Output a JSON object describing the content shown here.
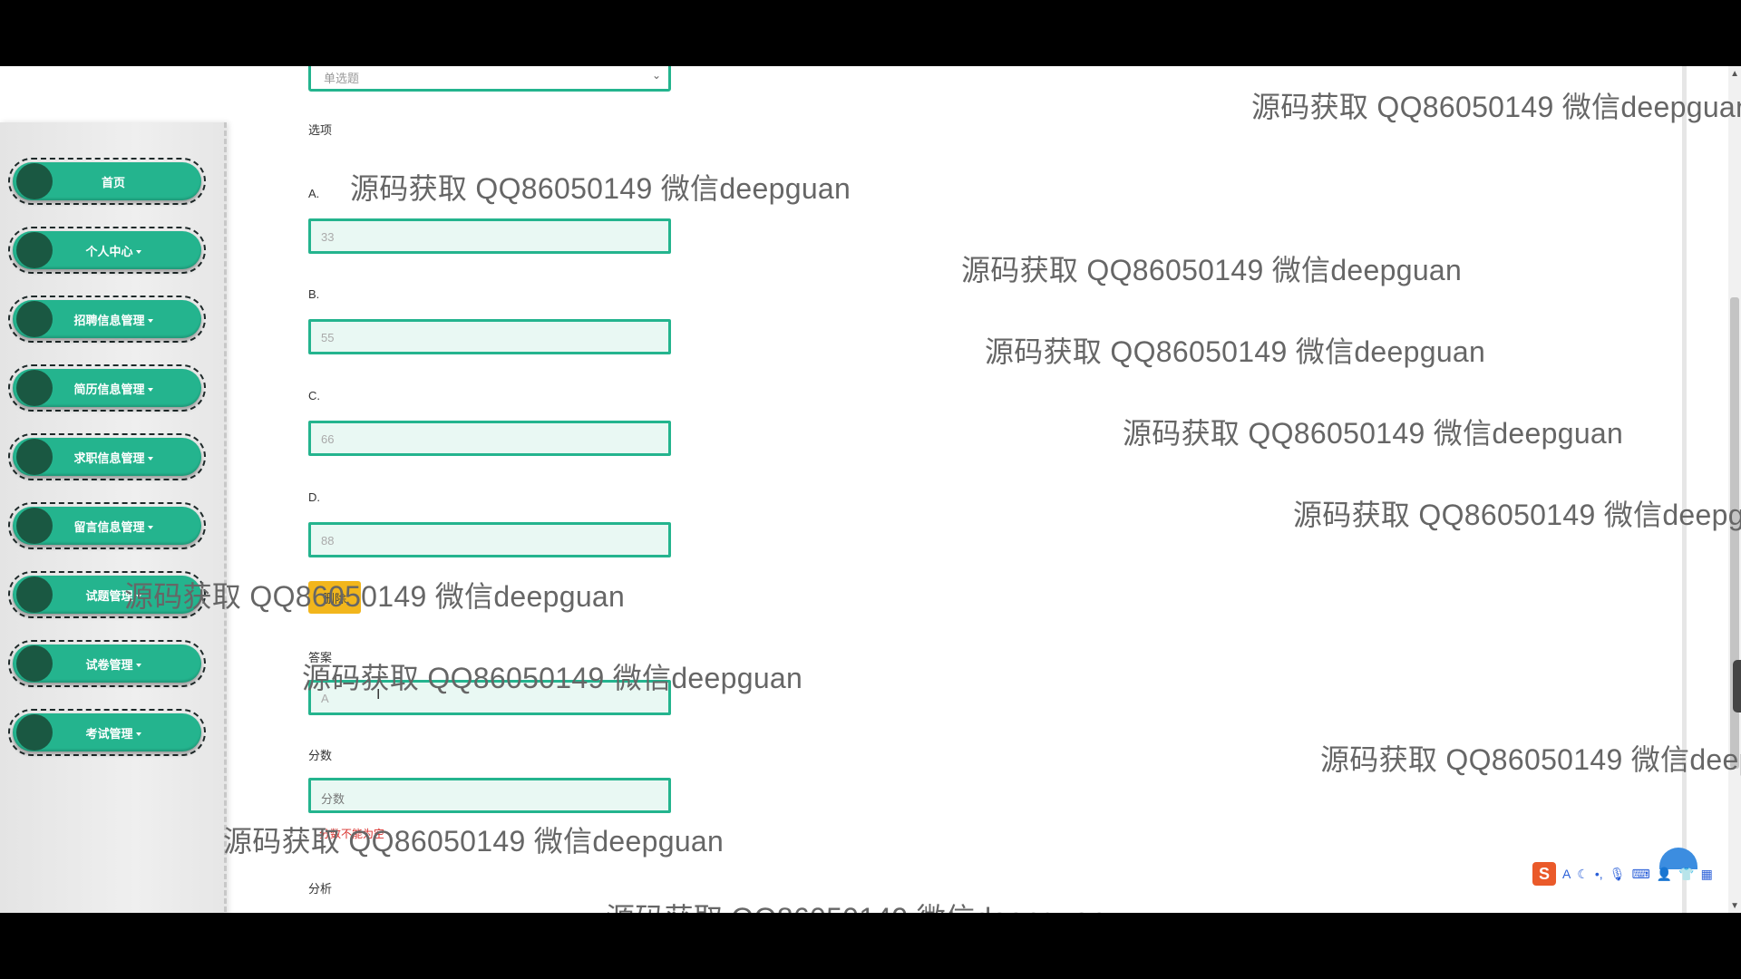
{
  "sidebar": {
    "items": [
      {
        "label": "首页",
        "has_caret": false
      },
      {
        "label": "个人中心",
        "has_caret": true
      },
      {
        "label": "招聘信息管理",
        "has_caret": true
      },
      {
        "label": "简历信息管理",
        "has_caret": true
      },
      {
        "label": "求职信息管理",
        "has_caret": true
      },
      {
        "label": "留言信息管理",
        "has_caret": true
      },
      {
        "label": "试题管理",
        "has_caret": true
      },
      {
        "label": "试卷管理",
        "has_caret": true
      },
      {
        "label": "考试管理",
        "has_caret": true
      }
    ]
  },
  "form": {
    "type_select": {
      "value": "单选题"
    },
    "options_label": "选项",
    "options": [
      {
        "label": "A.",
        "value": "33"
      },
      {
        "label": "B.",
        "value": "55"
      },
      {
        "label": "C.",
        "value": "66"
      },
      {
        "label": "D.",
        "value": "88"
      }
    ],
    "delete_label": "删除",
    "answer_label": "答案",
    "answer_value": "A",
    "score_label": "分数",
    "score_placeholder": "分数",
    "score_error": "分数不能为空",
    "analysis_label": "分析"
  },
  "watermark": "源码获取 QQ86050149 微信deepguan",
  "ime": {
    "brand_letter": "S",
    "mode": "A"
  },
  "colors": {
    "accent": "#24b48e",
    "nav_dot": "#1a5842",
    "delete_button": "#f2b61c",
    "input_bg": "#e9f8f3",
    "error": "#d9302c"
  }
}
